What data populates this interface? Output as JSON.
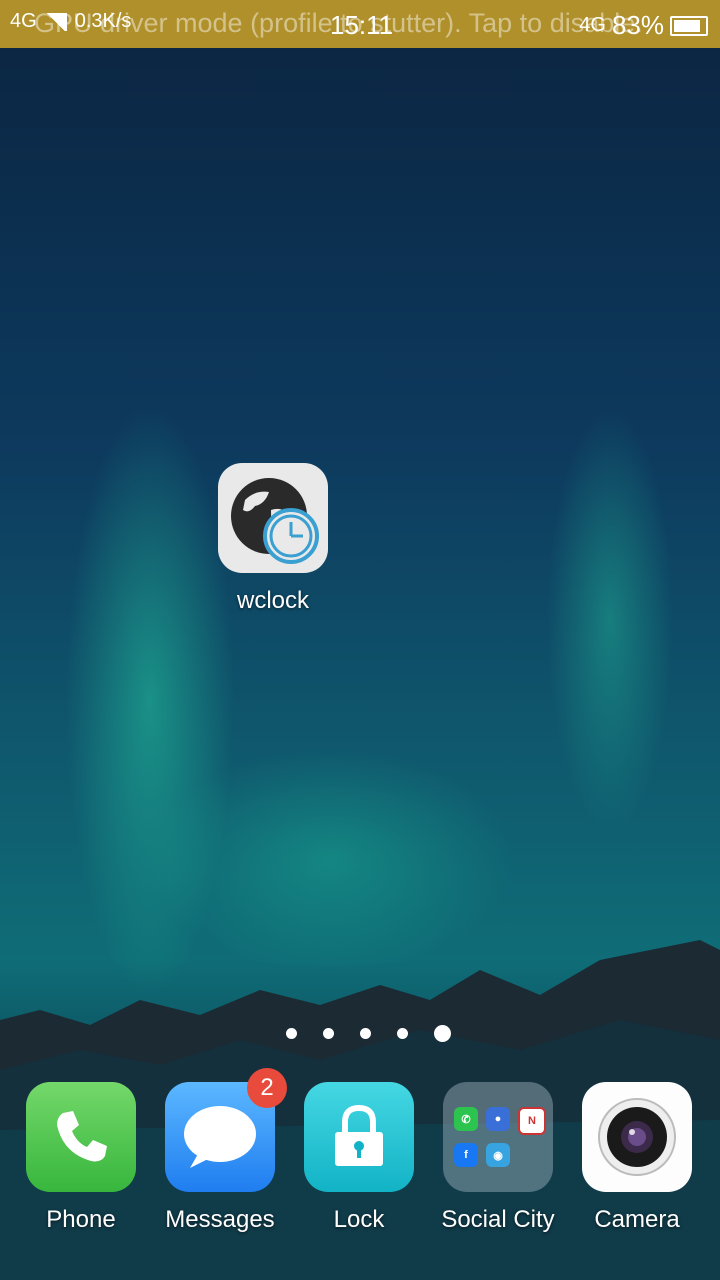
{
  "status_bar": {
    "network_left": "4G",
    "network_right": "4G",
    "speed": "0.3K/s",
    "time": "15:11",
    "battery": "83%",
    "overlay_text": "GPU driver mode (profile to stutter). Tap to disable."
  },
  "home": {
    "apps": [
      {
        "label": "wclock",
        "icon": "world-clock-icon"
      }
    ],
    "page_indicator": {
      "count": 5,
      "active_index": 4
    }
  },
  "dock": {
    "apps": [
      {
        "label": "Phone",
        "icon": "phone-icon"
      },
      {
        "label": "Messages",
        "icon": "chat-bubble-icon",
        "badge": "2"
      },
      {
        "label": "Lock",
        "icon": "padlock-icon"
      },
      {
        "label": "Social City",
        "icon": "folder-icon",
        "folder_icons": [
          "whatsapp-icon",
          "contacts-icon",
          "nif-icon",
          "facebook-icon",
          "app-icon"
        ]
      },
      {
        "label": "Camera",
        "icon": "camera-lens-icon"
      }
    ]
  },
  "colors": {
    "status_bar_bg": "#b0902a",
    "badge_red": "#e84b3c"
  }
}
